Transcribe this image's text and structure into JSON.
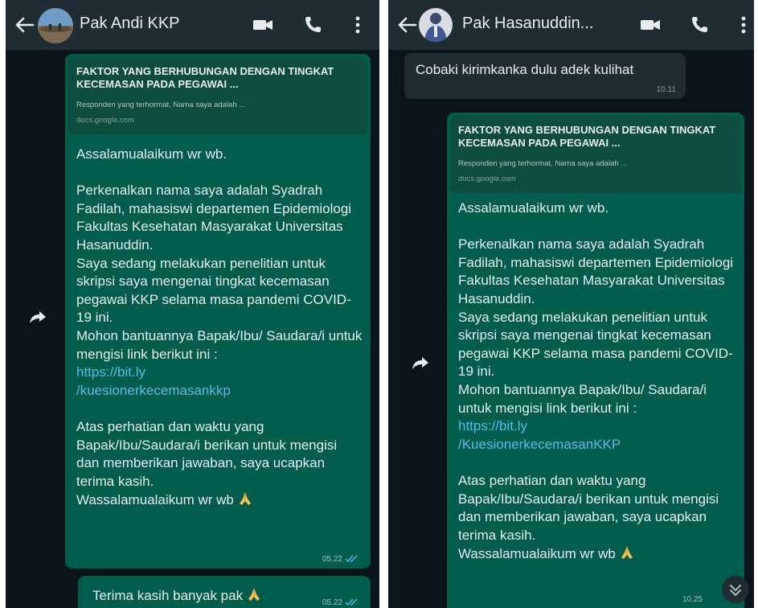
{
  "left": {
    "contact_name": "Pak Andi KKP",
    "preview": {
      "title": "FAKTOR YANG BERHUBUNGAN DENGAN TINGKAT KECEMASAN PADA PEGAWAI ...",
      "description": "Responden yang terhormat, Nama saya adalah ...",
      "domain": "docs.google.com"
    },
    "message": {
      "greeting": "Assalamualaikum wr wb.",
      "intro": "Perkenalkan nama saya adalah Syadrah Fadilah, mahasiswi departemen Epidemiologi Fakultas Kesehatan Masyarakat Universitas Hasanuddin.",
      "purpose": "Saya sedang melakukan penelitian untuk skripsi saya mengenai tingkat kecemasan pegawai KKP selama masa pandemi COVID-19 ini.",
      "request": "Mohon bantuannya Bapak/Ibu/ Saudara/i untuk mengisi link berikut ini :",
      "link_line1": "https://bit.ly",
      "link_line2": "/kuesionerkecemasankkp",
      "closing": "Atas perhatian dan waktu yang Bapak/Ibu/Saudara/i berikan untuk mengisi dan memberikan jawaban, saya ucapkan terima kasih.",
      "signoff": "Wassalamualaikum wr wb",
      "time": "05.22"
    },
    "message2": {
      "text": "Terima kasih banyak pak",
      "time": "05.22"
    }
  },
  "right": {
    "contact_name": "Pak Hasanuddin...",
    "incoming": {
      "text": "Cobaki kirimkanka dulu adek kulihat",
      "time": "10.11"
    },
    "preview": {
      "title": "FAKTOR YANG BERHUBUNGAN DENGAN TINGKAT KECEMASAN PADA PEGAWAI ...",
      "description": "Responden yang terhormat, Nama saya adalah ...",
      "domain": "docs.google.com"
    },
    "message": {
      "greeting": "Assalamualaikum wr wb.",
      "intro": "Perkenalkan nama saya adalah Syadrah Fadilah, mahasiswi departemen Epidemiologi Fakultas Kesehatan Masyarakat Universitas Hasanuddin.",
      "purpose": "Saya sedang melakukan penelitian untuk skripsi saya mengenai tingkat kecemasan pegawai KKP selama masa pandemi COVID-19 ini.",
      "request": "Mohon bantuannya Bapak/Ibu/ Saudara/i untuk mengisi link berikut ini :",
      "link_line1": "https://bit.ly",
      "link_line2": "/KuesionerkecemasanKKP",
      "closing": "Atas perhatian dan waktu yang Bapak/Ibu/Saudara/i berikan untuk mengisi dan memberikan jawaban, saya ucapkan terima kasih.",
      "signoff": "Wassalamualaikum wr wb",
      "time": "10.25"
    }
  },
  "icons": [
    "back-arrow-icon",
    "avatar",
    "video-call-icon",
    "phone-icon",
    "more-options-icon",
    "forward-icon",
    "read-receipt-icon",
    "praying-hands-emoji",
    "scroll-down-icon"
  ],
  "colors": {
    "header": "#1f2c33",
    "chat_background": "#0b141a",
    "outgoing_bubble": "#005c4b",
    "incoming_bubble": "#1f2c33",
    "link": "#53bdeb",
    "read_tick": "#53bdeb"
  }
}
